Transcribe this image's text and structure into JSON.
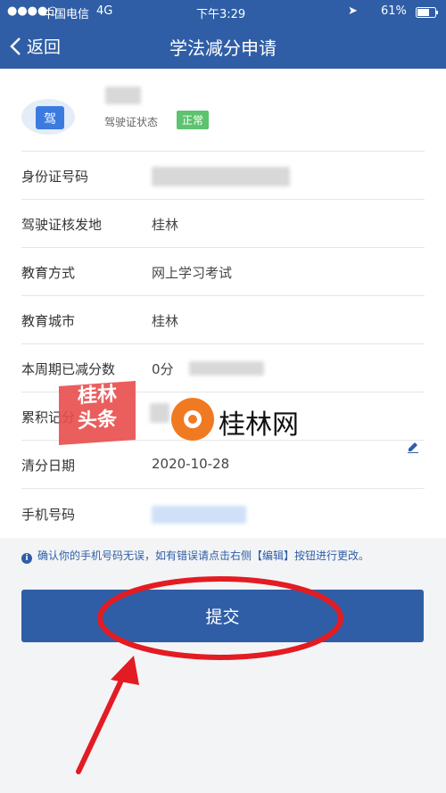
{
  "status_bar": {
    "carrier": "中国电信",
    "network": "4G",
    "time": "下午3:29",
    "battery": "61%"
  },
  "nav": {
    "back_label": "返回",
    "title": "学法减分申请"
  },
  "license": {
    "icon_char": "驾",
    "status_label": "驾驶证状态",
    "status_value": "正常"
  },
  "rows": [
    {
      "label": "身份证号码",
      "value": ""
    },
    {
      "label": "驾驶证核发地",
      "value": "桂林"
    },
    {
      "label": "教育方式",
      "value": "网上学习考试"
    },
    {
      "label": "教育城市",
      "value": "桂林"
    },
    {
      "label": "本周期已减分数",
      "value": "0分"
    },
    {
      "label": "累积记分",
      "value": ""
    },
    {
      "label": "清分日期",
      "value": "2020-10-28"
    },
    {
      "label": "手机号码",
      "value": ""
    }
  ],
  "notice": "确认你的手机号码无误，如有错误请点击右侧【编辑】按钮进行更改。",
  "submit_label": "提交",
  "watermark": {
    "badge_line1": "桂林",
    "badge_line2": "头条",
    "site_text": "桂林网"
  },
  "colors": {
    "primary": "#2f5ea6",
    "badge_green": "#5cc36e",
    "annotation_red": "#e31b23"
  },
  "icons": [
    "back-chevron-icon",
    "license-icon",
    "edit-pencil-icon",
    "info-icon"
  ]
}
